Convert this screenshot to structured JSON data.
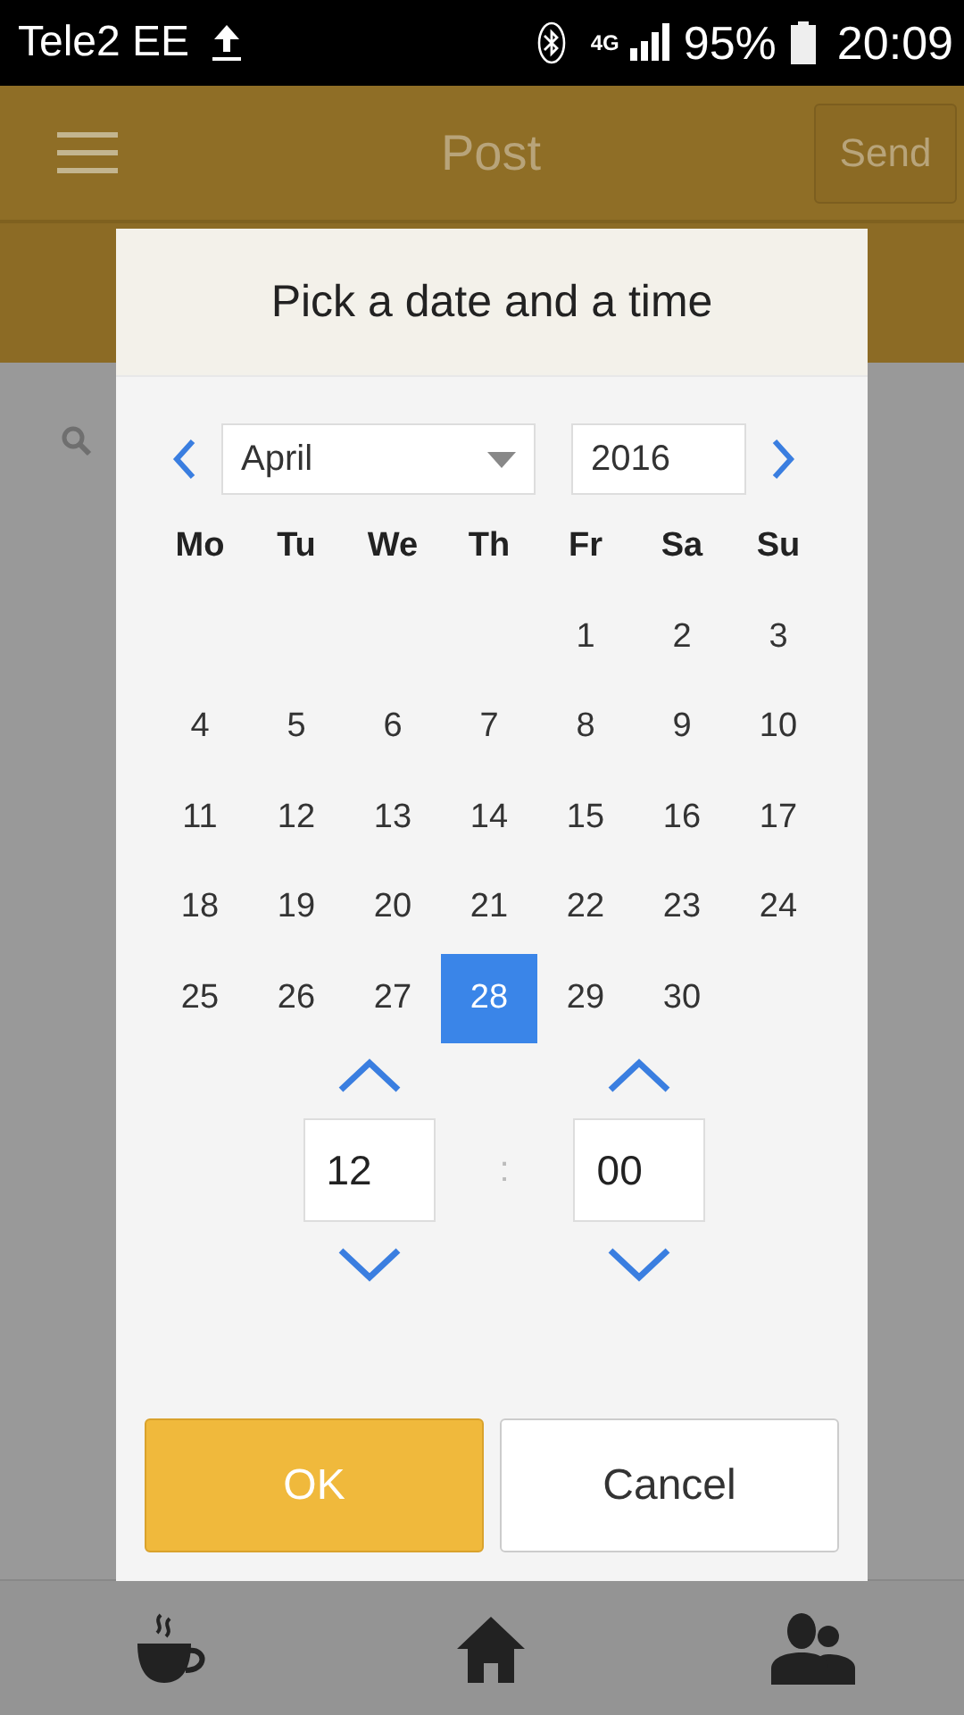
{
  "status_bar": {
    "carrier": "Tele2 EE",
    "network": "4G",
    "battery": "95%",
    "time": "20:09"
  },
  "header": {
    "title": "Post",
    "send_button": "Send"
  },
  "dialog": {
    "title": "Pick a date and a time",
    "month": "April",
    "year": "2016",
    "weekdays": [
      "Mo",
      "Tu",
      "We",
      "Th",
      "Fr",
      "Sa",
      "Su"
    ],
    "weeks": [
      [
        {
          "kind": "blank"
        },
        {
          "kind": "blank"
        },
        {
          "kind": "blank"
        },
        {
          "kind": "blank"
        },
        {
          "kind": "day",
          "label": "1",
          "selected": false
        },
        {
          "kind": "day",
          "label": "2",
          "selected": false
        },
        {
          "kind": "day",
          "label": "3",
          "selected": false
        }
      ],
      [
        {
          "kind": "day",
          "label": "4",
          "selected": false
        },
        {
          "kind": "day",
          "label": "5",
          "selected": false
        },
        {
          "kind": "day",
          "label": "6",
          "selected": false
        },
        {
          "kind": "day",
          "label": "7",
          "selected": false
        },
        {
          "kind": "day",
          "label": "8",
          "selected": false
        },
        {
          "kind": "day",
          "label": "9",
          "selected": false
        },
        {
          "kind": "day",
          "label": "10",
          "selected": false
        }
      ],
      [
        {
          "kind": "day",
          "label": "11",
          "selected": false
        },
        {
          "kind": "day",
          "label": "12",
          "selected": false
        },
        {
          "kind": "day",
          "label": "13",
          "selected": false
        },
        {
          "kind": "day",
          "label": "14",
          "selected": false
        },
        {
          "kind": "day",
          "label": "15",
          "selected": false
        },
        {
          "kind": "day",
          "label": "16",
          "selected": false
        },
        {
          "kind": "day",
          "label": "17",
          "selected": false
        }
      ],
      [
        {
          "kind": "day",
          "label": "18",
          "selected": false
        },
        {
          "kind": "day",
          "label": "19",
          "selected": false
        },
        {
          "kind": "day",
          "label": "20",
          "selected": false
        },
        {
          "kind": "day",
          "label": "21",
          "selected": false
        },
        {
          "kind": "day",
          "label": "22",
          "selected": false
        },
        {
          "kind": "day",
          "label": "23",
          "selected": false
        },
        {
          "kind": "day",
          "label": "24",
          "selected": false
        }
      ],
      [
        {
          "kind": "day",
          "label": "25",
          "selected": false
        },
        {
          "kind": "day",
          "label": "26",
          "selected": false
        },
        {
          "kind": "day",
          "label": "27",
          "selected": false
        },
        {
          "kind": "day",
          "label": "28",
          "selected": true
        },
        {
          "kind": "day",
          "label": "29",
          "selected": false
        },
        {
          "kind": "day",
          "label": "30",
          "selected": false
        },
        {
          "kind": "blank"
        }
      ]
    ],
    "hour": "12",
    "separator": ":",
    "minute": "00",
    "ok_button": "OK",
    "cancel_button": "Cancel"
  }
}
